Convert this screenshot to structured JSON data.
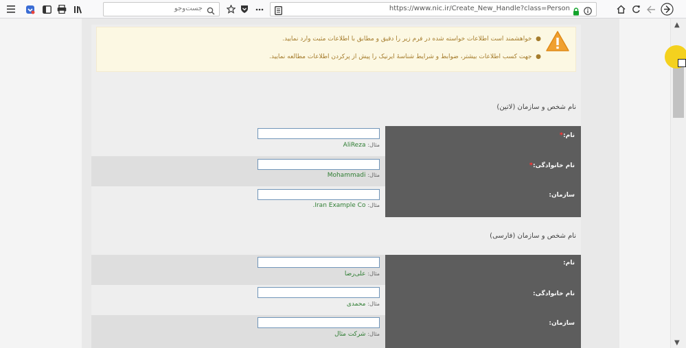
{
  "toolbar": {
    "search_placeholder": "جست‌وجو",
    "url": "https://www.nic.ir/Create_New_Handle?class=Person",
    "icons": [
      "menu-icon",
      "pocket-icon",
      "sidebar-icon",
      "print-icon",
      "library-icon",
      "star-icon",
      "shield-icon",
      "more-icon",
      "reader-icon",
      "lock-icon",
      "info-icon",
      "home-icon",
      "reload-icon",
      "back-icon",
      "forward-icon"
    ]
  },
  "alert": {
    "line1": "خواهشمند است اطلاعات خواسته شده در فرم زیر را دقیق و مطابق با اطلاعات مثبت وارد نمایید.",
    "line2": "جهت کسب اطلاعات بیشتر، ضوابط و شرایط شناسهٔ ایرنیک را پیش از پرکردن اطلاعات مطالعه نمایید."
  },
  "section_latin": {
    "title": "نام شخص و سازمان (لاتین)",
    "fields": [
      {
        "label": "نام:",
        "required_mark": "*",
        "example_label": "مثال:",
        "example": "AliReza"
      },
      {
        "label": "نام خانوادگی:",
        "required_mark": "*",
        "example_label": "مثال:",
        "example": "Mohammadi"
      },
      {
        "label": "سازمان:",
        "example_label": "مثال:",
        "example": "Iran Example Co."
      }
    ]
  },
  "section_persian": {
    "title": "نام شخص و سازمان (فارسی)",
    "fields": [
      {
        "label": "نام:",
        "example_label": "مثال:",
        "example": "علی‌رضا"
      },
      {
        "label": "نام خانوادگی:",
        "example_label": "مثال:",
        "example": "محمدی"
      },
      {
        "label": "سازمان:",
        "example_label": "مثال:",
        "example": "شرکت مثال"
      }
    ]
  },
  "colors": {
    "alert_bg": "#fcf8e3",
    "alert_text": "#a57c2c",
    "label_panel": "#5d5d5d",
    "example_text": "#2e7d32",
    "required": "#ff3333"
  }
}
